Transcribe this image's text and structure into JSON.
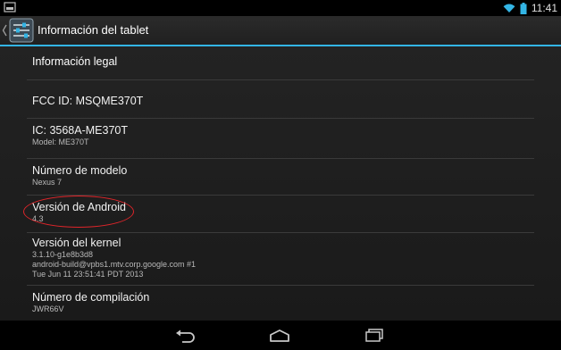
{
  "status_bar": {
    "time": "11:41",
    "left_icon": "notification-box-icon",
    "wifi_icon": "wifi-icon",
    "battery_icon": "battery-icon",
    "accent_color": "#33b5e5"
  },
  "action_bar": {
    "title": "Información del tablet",
    "up_icon": "up-caret-icon",
    "app_icon": "settings-icon"
  },
  "items": [
    {
      "title": "Información legal",
      "summary": []
    },
    {
      "title": "FCC ID: MSQME370T",
      "summary": []
    },
    {
      "title": "IC: 3568A-ME370T",
      "summary": [
        "Model: ME370T"
      ]
    },
    {
      "title": "Número de modelo",
      "summary": [
        "Nexus 7"
      ]
    },
    {
      "title": "Versión de Android",
      "summary": [
        "4.3"
      ]
    },
    {
      "title": "Versión del kernel",
      "summary": [
        "3.1.10-g1e8b3d8",
        "android-build@vpbs1.mtv.corp.google.com #1",
        "Tue Jun 11 23:51:41 PDT 2013"
      ]
    },
    {
      "title": "Número de compilación",
      "summary": [
        "JWR66V"
      ]
    }
  ],
  "highlight_color": "#e0252a",
  "nav_bar": {
    "back_icon": "back-icon",
    "home_icon": "home-icon",
    "recents_icon": "recent-apps-icon"
  }
}
